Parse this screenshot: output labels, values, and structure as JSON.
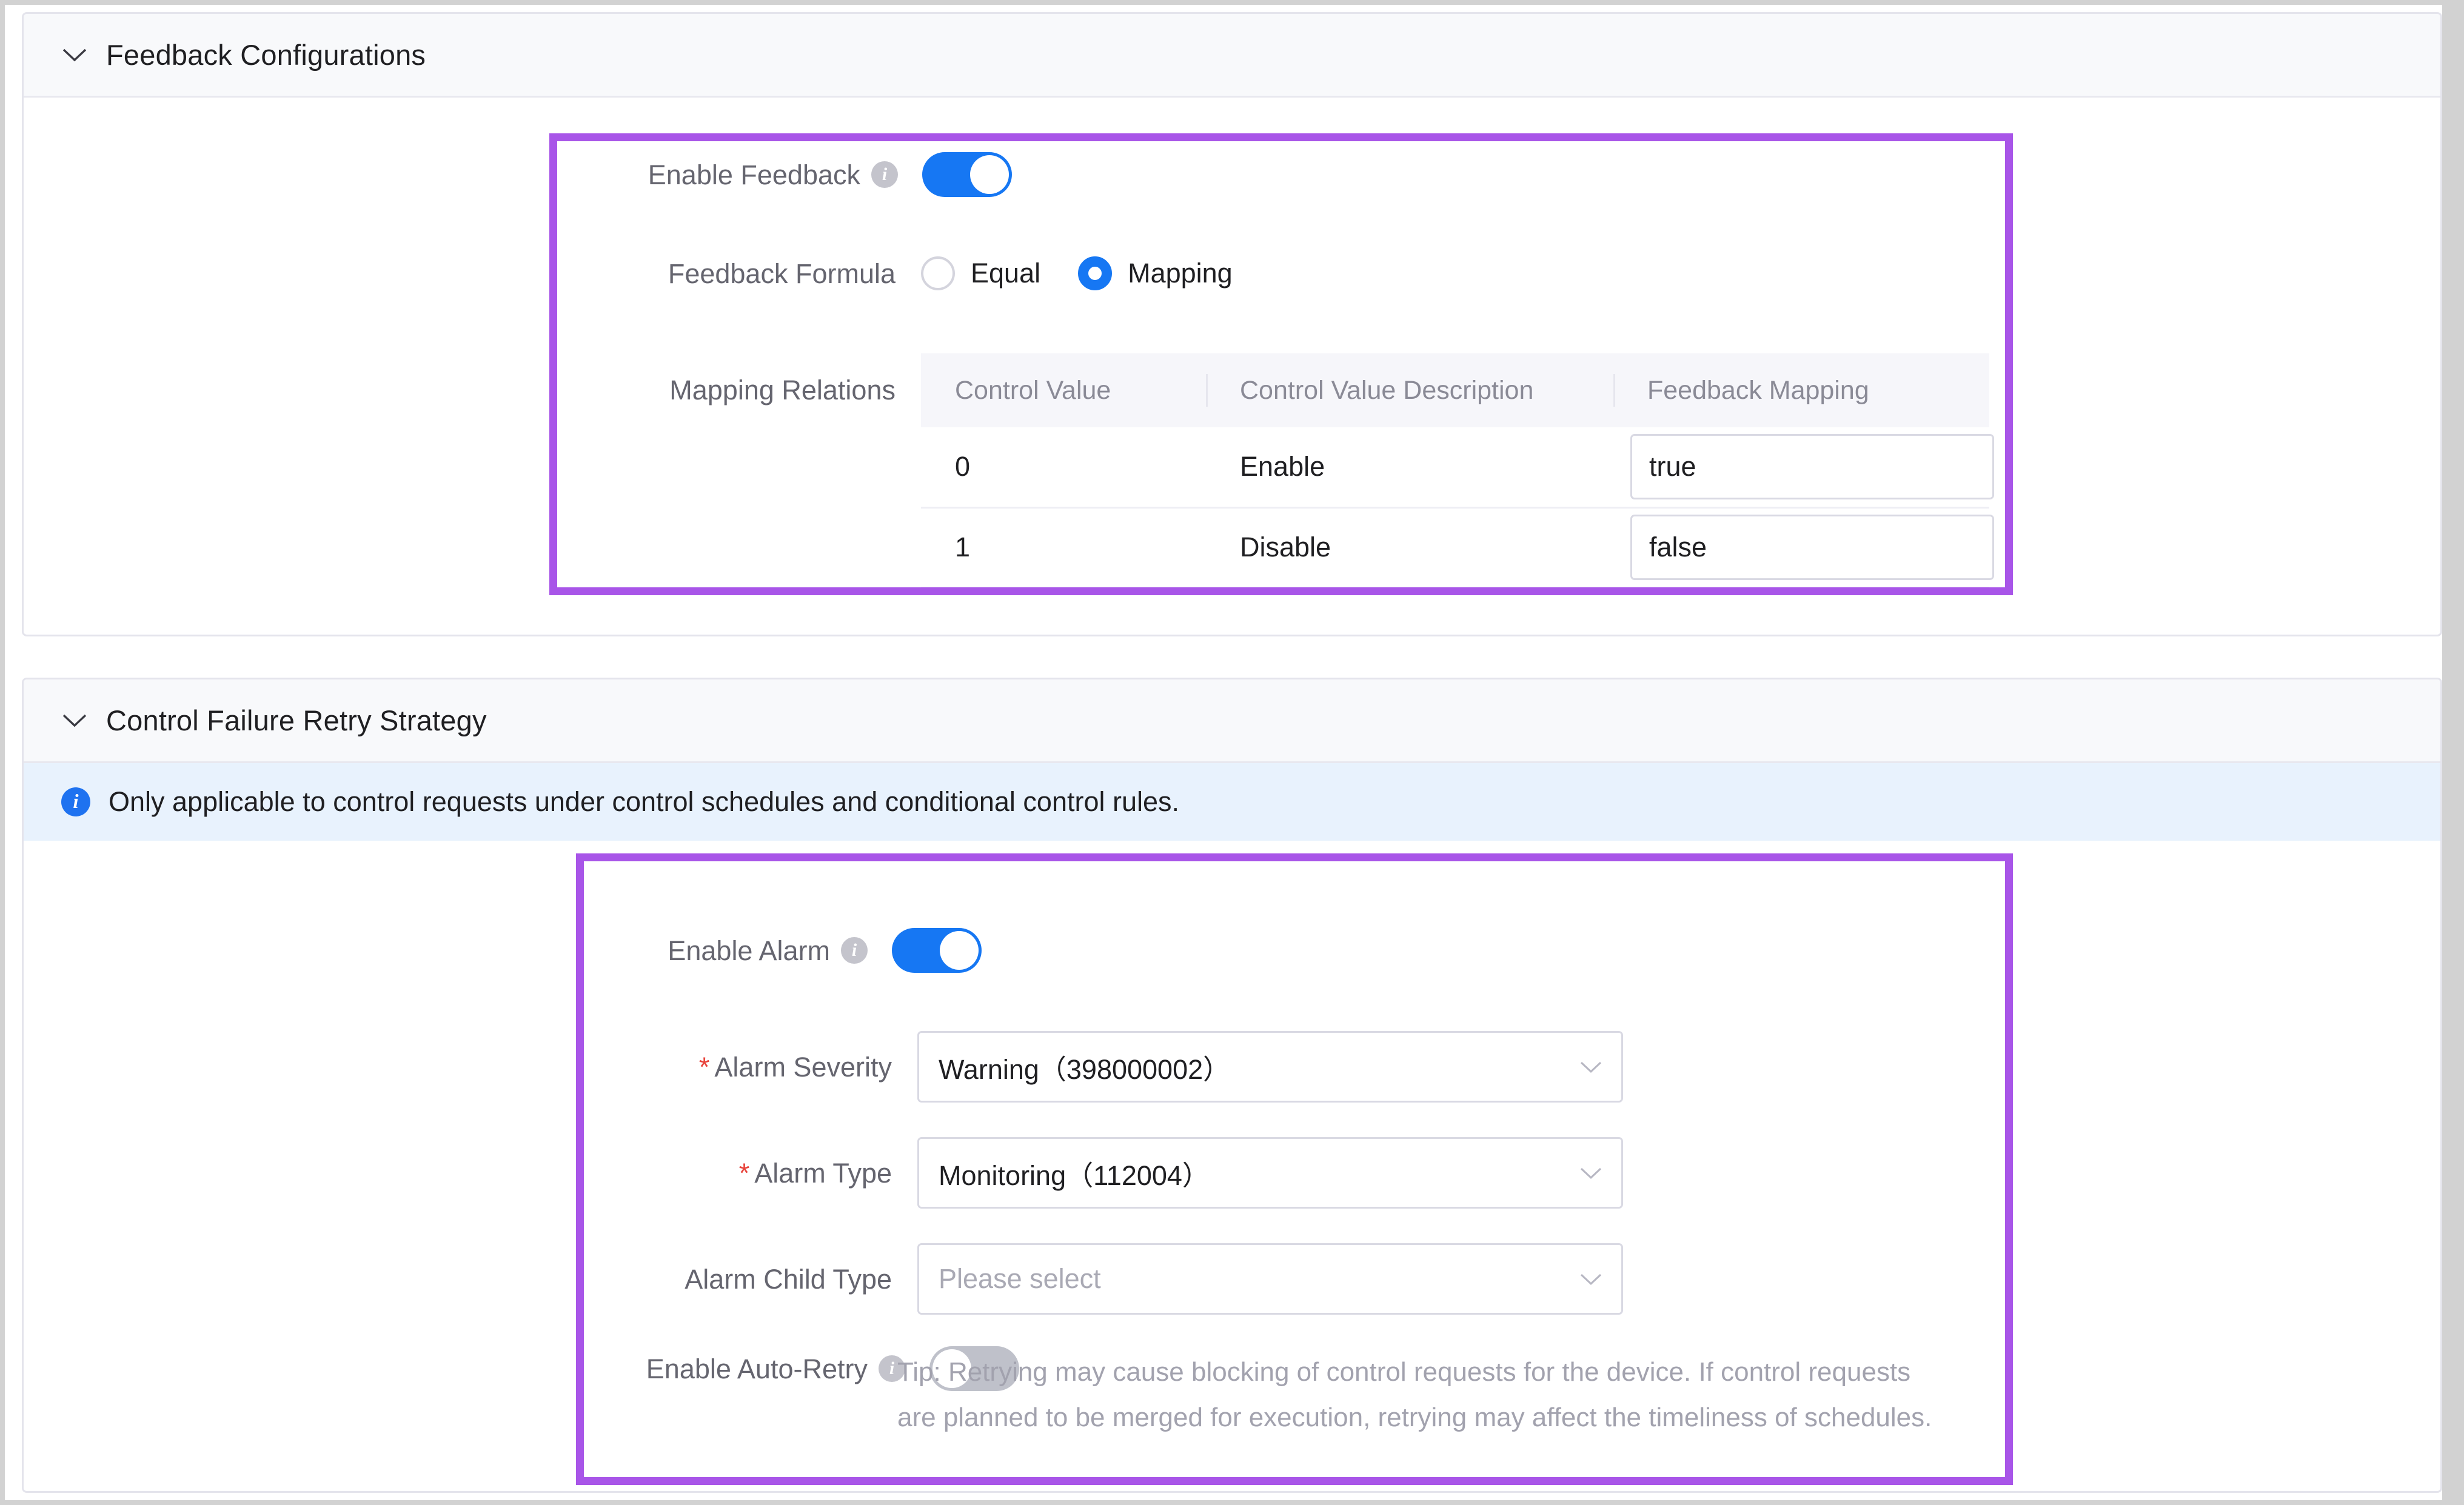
{
  "panels": {
    "feedback": {
      "title": "Feedback Configurations",
      "chevron_icon": "chevron-down-icon",
      "enable_feedback": {
        "label": "Enable Feedback",
        "info_icon": "info-circle-icon",
        "state": "on"
      },
      "feedback_formula": {
        "label": "Feedback Formula",
        "options": [
          {
            "label": "Equal",
            "selected": false
          },
          {
            "label": "Mapping",
            "selected": true
          }
        ]
      },
      "mapping_relations": {
        "label": "Mapping Relations",
        "columns": [
          "Control Value",
          "Control Value Description",
          "Feedback Mapping"
        ],
        "rows": [
          {
            "control_value": "0",
            "description": "Enable",
            "feedback_mapping": "true"
          },
          {
            "control_value": "1",
            "description": "Disable",
            "feedback_mapping": "false"
          }
        ]
      }
    },
    "retry": {
      "title": "Control Failure Retry Strategy",
      "chevron_icon": "chevron-down-icon",
      "banner": {
        "icon": "info-circle-filled-icon",
        "text": "Only applicable to control requests under control schedules and conditional control rules."
      },
      "enable_alarm": {
        "label": "Enable Alarm",
        "info_icon": "info-circle-icon",
        "state": "on"
      },
      "alarm_severity": {
        "label": "Alarm Severity",
        "required_mark": "*",
        "value": "Warning（398000002）",
        "caret_icon": "chevron-down-icon"
      },
      "alarm_type": {
        "label": "Alarm Type",
        "required_mark": "*",
        "value": "Monitoring（112004）",
        "caret_icon": "chevron-down-icon"
      },
      "alarm_child_type": {
        "label": "Alarm Child Type",
        "placeholder": "Please select",
        "value": "",
        "caret_icon": "chevron-down-icon"
      },
      "enable_auto_retry": {
        "label": "Enable Auto-Retry",
        "info_icon": "info-circle-icon",
        "state": "off"
      },
      "tip": "Tip: Retrying may cause blocking of control requests for the device. If control requests are planned to be merged for execution, retrying may affect the timeliness of schedules."
    }
  },
  "colors": {
    "highlight": "#a855e8",
    "toggle_on": "#1677f3",
    "toggle_off": "#bfc1ca",
    "required": "#e8443c",
    "banner_bg": "#e8f2fd",
    "banner_icon": "#1e72f0"
  }
}
